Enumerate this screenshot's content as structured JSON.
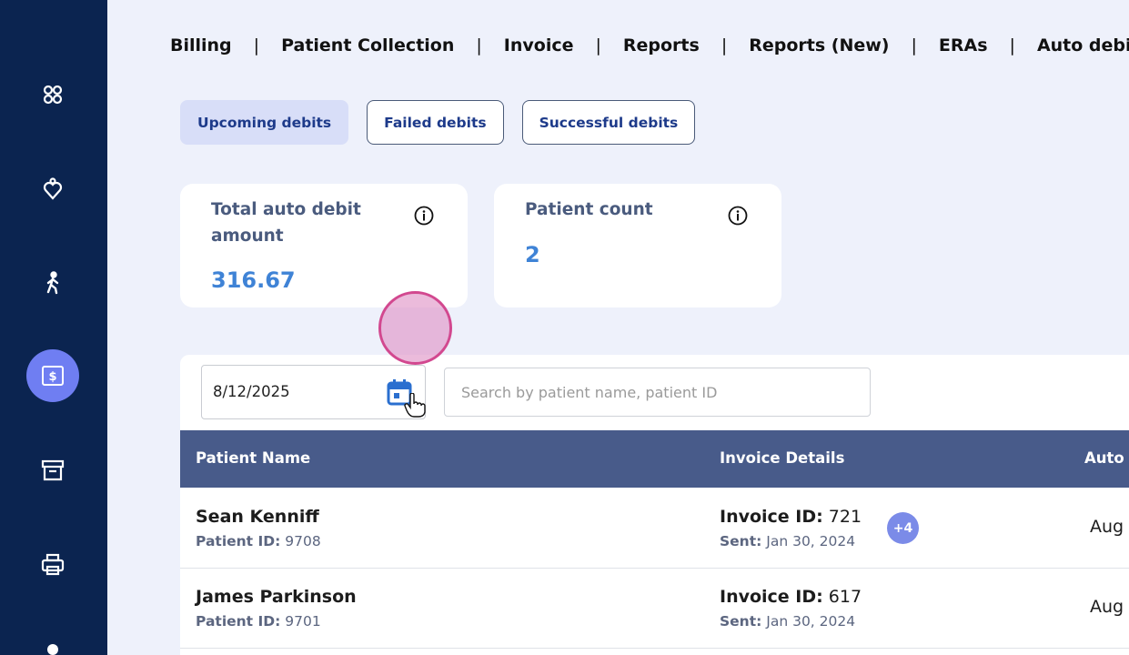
{
  "nav": {
    "items": [
      "Billing",
      "Patient Collection",
      "Invoice",
      "Reports",
      "Reports (New)",
      "ERAs",
      "Auto debit"
    ],
    "separator": "|"
  },
  "sidebar": {
    "icons": [
      "grid-icon",
      "location-heart-icon",
      "walking-person-icon",
      "dollar-bill-icon",
      "archive-icon",
      "printer-icon",
      "person-icon"
    ],
    "active_icon": "dollar-bill-icon"
  },
  "subtabs": {
    "upcoming": "Upcoming debits",
    "failed": "Failed debits",
    "successful": "Successful debits"
  },
  "cards": {
    "total": {
      "label": "Total auto debit amount",
      "value": "316.67"
    },
    "count": {
      "label": "Patient count",
      "value": "2"
    }
  },
  "filters": {
    "date": "8/12/2025",
    "search_placeholder": "Search by patient name, patient ID"
  },
  "table": {
    "columns": [
      "Patient Name",
      "Invoice Details",
      "Auto D"
    ],
    "rows": [
      {
        "name": "Sean Kenniff",
        "pid_label": "Patient ID:",
        "pid": "9708",
        "inv_label": "Invoice ID:",
        "inv": "721",
        "sent_label": "Sent:",
        "sent": "Jan 30, 2024",
        "badge": "+4",
        "auto": "Aug"
      },
      {
        "name": "James Parkinson",
        "pid_label": "Patient ID:",
        "pid": "9701",
        "inv_label": "Invoice ID:",
        "inv": "617",
        "sent_label": "Sent:",
        "sent": "Jan 30, 2024",
        "badge": "",
        "auto": "Aug"
      }
    ]
  },
  "colors": {
    "sidebar": "#0b2450",
    "active_icon_bg": "#6f7ef2",
    "table_header": "#485b8a",
    "value_blue": "#3f83d6",
    "badge": "#7b8be8"
  }
}
